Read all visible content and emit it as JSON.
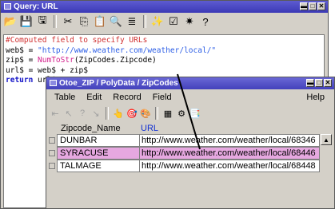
{
  "query_window": {
    "title": "Query: URL",
    "code": {
      "line1": "#Computed field to specify URLs",
      "line2_var": "web$ = ",
      "line2_str": "\"http://www.weather.com/weather/local/\"",
      "line3_var": "zip$ = ",
      "line3_fn": "NumToStr",
      "line3_rest": "(ZipCodes.Zipcode)",
      "line4": "url$ = web$ + zip$",
      "line5_kw": "return",
      "line5_rest": " url$"
    }
  },
  "table_window": {
    "title": "Otoe_ZIP / PolyData / ZipCodes",
    "menu": [
      "Table",
      "Edit",
      "Record",
      "Field"
    ],
    "help": "Help",
    "columns": [
      "Zipcode_Name",
      "URL"
    ],
    "rows": [
      {
        "name": "DUNBAR",
        "url": "http://www.weather.com/weather/local/68346"
      },
      {
        "name": "SYRACUSE",
        "url": "http://www.weather.com/weather/local/68446"
      },
      {
        "name": "TALMAGE",
        "url": "http://www.weather.com/weather/local/68448"
      }
    ],
    "selected_row": "SYRACUSE"
  },
  "colors": {
    "titlebar": "#3b39b6",
    "selected_row": "#e6a8e0",
    "comment": "#d03030",
    "string": "#2c5ee6",
    "function": "#d31f8c"
  }
}
